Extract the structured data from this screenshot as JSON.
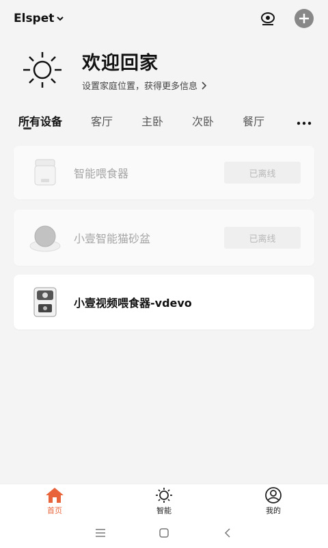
{
  "header": {
    "home_name": "Elspet",
    "icons": {
      "switch": "chevron-down-icon",
      "camera": "eye-camera-icon",
      "add": "plus-circle-icon"
    }
  },
  "welcome": {
    "title": "欢迎回家",
    "subtitle": "设置家庭位置，获得更多信息",
    "icon": "sun-icon"
  },
  "tabs": [
    {
      "label": "所有设备",
      "active": true
    },
    {
      "label": "客厅"
    },
    {
      "label": "主卧"
    },
    {
      "label": "次卧"
    },
    {
      "label": "餐厅"
    }
  ],
  "devices": [
    {
      "name": "智能喂食器",
      "status": "已离线",
      "online": false,
      "icon": "feeder-icon"
    },
    {
      "name": "小壹智能猫砂盆",
      "status": "已离线",
      "online": false,
      "icon": "litter-box-icon"
    },
    {
      "name": "小壹视频喂食器-vdevo",
      "status": "",
      "online": true,
      "icon": "video-feeder-icon"
    }
  ],
  "bottom_nav": [
    {
      "label": "首页",
      "icon": "home-icon",
      "active": true
    },
    {
      "label": "智能",
      "icon": "smart-sun-icon",
      "active": false
    },
    {
      "label": "我的",
      "icon": "profile-icon",
      "active": false
    }
  ],
  "system_nav": {
    "icons": [
      "menu-icon",
      "home-square-icon",
      "back-icon"
    ]
  },
  "colors": {
    "accent": "#e8633a",
    "background": "#f4f4f4",
    "card": "#ffffff"
  }
}
